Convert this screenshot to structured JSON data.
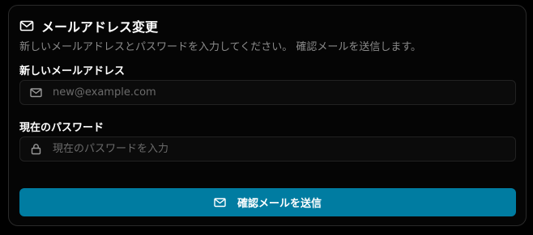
{
  "card": {
    "title": "メールアドレス変更",
    "title_icon": "mail-icon",
    "description": "新しいメールアドレスとパスワードを入力してください。 確認メールを送信します。"
  },
  "email_field": {
    "label": "新しいメールアドレス",
    "placeholder": "new@example.com",
    "value": "",
    "icon": "mail-icon"
  },
  "password_field": {
    "label": "現在のパスワード",
    "placeholder": "現在のパスワードを入力",
    "value": "",
    "icon": "lock-icon"
  },
  "submit": {
    "label": "確認メールを送信",
    "icon": "mail-icon"
  },
  "colors": {
    "background": "#000000",
    "card_background": "#050505",
    "card_border": "#2a2a2a",
    "input_background": "#0b0b0b",
    "accent": "#007ca1",
    "muted_text": "#8a8a8a",
    "placeholder_text": "#6b6b6b"
  }
}
